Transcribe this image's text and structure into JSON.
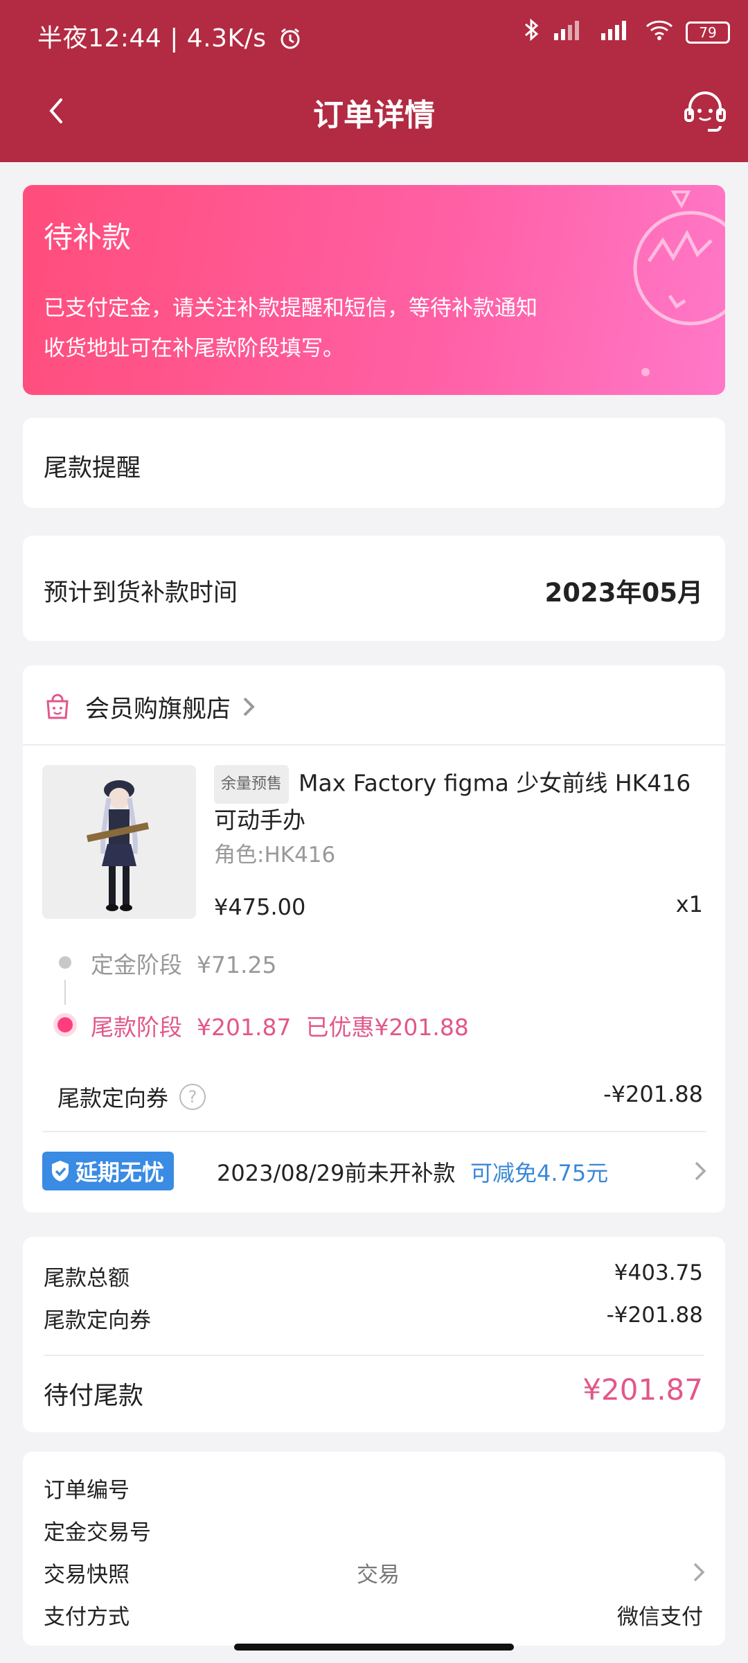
{
  "status_bar": {
    "time": "半夜12:44",
    "speed": "4.3K/s",
    "battery": "79"
  },
  "header": {
    "title": "订单详情"
  },
  "banner": {
    "title": "待补款",
    "line1": "已支付定金，请关注补款提醒和短信，等待补款通知",
    "line2": "收货地址可在补尾款阶段填写。"
  },
  "reminder": {
    "label": "尾款提醒"
  },
  "arrival": {
    "label": "预计到货补款时间",
    "value": "2023年05月"
  },
  "store": {
    "name": "会员购旗舰店"
  },
  "product": {
    "tag": "余量预售",
    "title": "Max Factory figma 少女前线 HK416 可动手办",
    "variant": "角色:HK416",
    "price": "¥475.00",
    "qty": "x1"
  },
  "stages": {
    "deposit_label": "定金阶段",
    "deposit_amount": "¥71.25",
    "final_label": "尾款阶段",
    "final_amount": "¥201.87",
    "final_discount": "已优惠¥201.88"
  },
  "coupon": {
    "label": "尾款定向券",
    "help_icon": "?",
    "value": "-¥201.88"
  },
  "delay": {
    "badge": "延期无忧",
    "text": "2023/08/29前未开补款",
    "benefit": "可减免4.75元"
  },
  "summary": {
    "total_label": "尾款总额",
    "total_value": "¥403.75",
    "coupon_label": "尾款定向券",
    "coupon_value": "-¥201.88",
    "pay_label": "待付尾款",
    "pay_value": "¥201.87"
  },
  "order_info": {
    "order_no_label": "订单编号",
    "deposit_txn_label": "定金交易号",
    "snapshot_label": "交易快照",
    "snapshot_value": "交易",
    "payment_label": "支付方式",
    "payment_value": "微信支付"
  },
  "colors": {
    "header": "#b22b42",
    "accent": "#e2578a",
    "link": "#3a88d6"
  }
}
